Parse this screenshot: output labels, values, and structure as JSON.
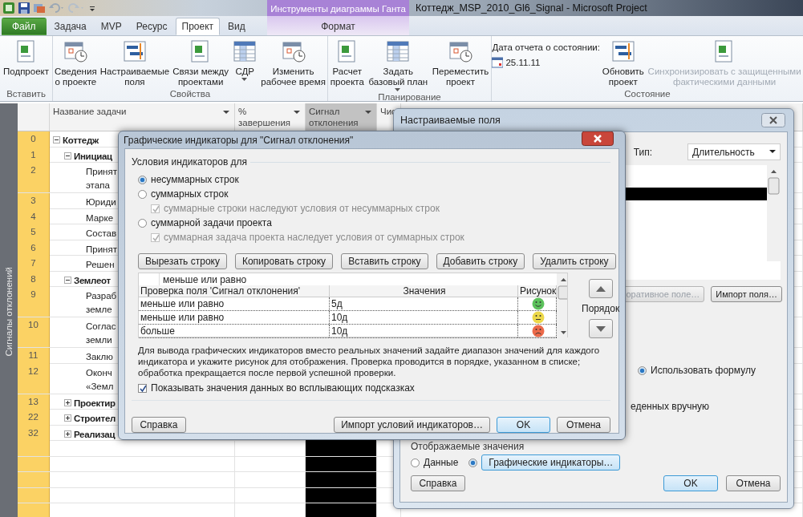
{
  "window": {
    "title": "Коттедж_MSP_2010_Gl6_Signal  -  Microsoft Project"
  },
  "contextual_group": "Инструменты диаграммы Ганта",
  "tabs": [
    {
      "label": "Файл",
      "kind": "file",
      "selected": false
    },
    {
      "label": "Задача",
      "kind": "normal",
      "selected": false
    },
    {
      "label": "MVP",
      "kind": "normal",
      "selected": false
    },
    {
      "label": "Ресурс",
      "kind": "normal",
      "selected": false
    },
    {
      "label": "Проект",
      "kind": "normal",
      "selected": true
    },
    {
      "label": "Вид",
      "kind": "normal",
      "selected": false
    },
    {
      "label": "Формат",
      "kind": "contextual",
      "selected": false
    }
  ],
  "ribbon": {
    "groups": [
      {
        "label": "Вставить",
        "items": [
          {
            "kind": "button",
            "lines": [
              "Подпроект"
            ],
            "dropdown": false,
            "disabled": false
          }
        ]
      },
      {
        "label": "Свойства",
        "items": [
          {
            "kind": "button",
            "lines": [
              "Сведения",
              "о проекте"
            ],
            "dropdown": false,
            "disabled": false
          },
          {
            "kind": "button",
            "lines": [
              "Настраиваемые",
              "поля"
            ],
            "dropdown": false,
            "disabled": false
          },
          {
            "kind": "button",
            "lines": [
              "Связи между",
              "проектами"
            ],
            "dropdown": false,
            "disabled": false
          },
          {
            "kind": "button",
            "lines": [
              "СДР"
            ],
            "dropdown": true,
            "disabled": false
          },
          {
            "kind": "button",
            "lines": [
              "Изменить",
              "рабочее время"
            ],
            "dropdown": false,
            "disabled": false
          }
        ]
      },
      {
        "label": "Планирование",
        "items": [
          {
            "kind": "button",
            "lines": [
              "Расчет",
              "проекта"
            ],
            "dropdown": false,
            "disabled": false
          },
          {
            "kind": "button",
            "lines": [
              "Задать",
              "базовый план"
            ],
            "dropdown": true,
            "disabled": false
          },
          {
            "kind": "button",
            "lines": [
              "Переместить",
              "проект"
            ],
            "dropdown": false,
            "disabled": false
          }
        ]
      },
      {
        "label": "Состояние",
        "items": [
          {
            "kind": "date",
            "label": "Дата отчета о состоянии:",
            "value": "25.11.11"
          },
          {
            "kind": "button",
            "lines": [
              "Обновить",
              "проект"
            ],
            "dropdown": false,
            "disabled": false
          },
          {
            "kind": "button",
            "lines": [
              "Синхронизировать с защищенными",
              "фактическими данными"
            ],
            "dropdown": false,
            "disabled": true
          }
        ]
      }
    ]
  },
  "side_label": "Сигналы отклонений",
  "table": {
    "columns": [
      {
        "label": "Название задачи",
        "selected": false
      },
      {
        "label": "% завершения",
        "selected": false
      },
      {
        "label": "Сигнал отклонения",
        "selected": true
      },
      {
        "label": "Чис",
        "selected": false
      }
    ]
  },
  "tasks": [
    {
      "id": "0",
      "lines": [
        "Коттедж"
      ],
      "summary": true,
      "expanded": true,
      "children": [
        {
          "id": "1",
          "lines": [
            "Инициац"
          ],
          "summary": true,
          "expanded": true,
          "children": [
            {
              "id": "2",
              "lines": [
                "Принят",
                "этапа"
              ],
              "summary": false
            },
            {
              "id": "3",
              "lines": [
                "Юриди"
              ],
              "summary": false
            },
            {
              "id": "4",
              "lines": [
                "Марке"
              ],
              "summary": false
            },
            {
              "id": "5",
              "lines": [
                "Состав"
              ],
              "summary": false
            },
            {
              "id": "6",
              "lines": [
                "Принят"
              ],
              "summary": false
            },
            {
              "id": "7",
              "lines": [
                "Решен"
              ],
              "summary": false
            }
          ]
        },
        {
          "id": "8",
          "lines": [
            "Землеот"
          ],
          "summary": true,
          "expanded": true,
          "children": [
            {
              "id": "9",
              "lines": [
                "Разраб",
                "земле"
              ],
              "summary": false
            },
            {
              "id": "10",
              "lines": [
                "Соглас",
                "земли"
              ],
              "summary": false
            },
            {
              "id": "11",
              "lines": [
                "Заклю"
              ],
              "summary": false
            },
            {
              "id": "12",
              "lines": [
                "Оконч",
                "«Земл"
              ],
              "summary": false
            }
          ]
        },
        {
          "id": "13",
          "lines": [
            "Проектир"
          ],
          "summary": true,
          "expanded": false
        },
        {
          "id": "22",
          "lines": [
            "Строител"
          ],
          "summary": true,
          "expanded": false
        },
        {
          "id": "32",
          "lines": [
            "Реализац"
          ],
          "summary": true,
          "expanded": false
        }
      ]
    }
  ],
  "custom_fields_dialog": {
    "title": "Настраиваемые поля",
    "type_label": "Тип:",
    "type_value": "Длительность",
    "buttons": [
      {
        "label": "оративное поле…",
        "disabled": true
      },
      {
        "label": "Импорт поля…",
        "disabled": false
      }
    ],
    "formula_option": {
      "label": "Использовать формулу",
      "selected": true
    },
    "partial_text": "еденных вручную",
    "display_label": "Отображаемые значения",
    "display_options": [
      {
        "label": "Данные",
        "selected": false,
        "kind": "radio"
      },
      {
        "label": "Графические индикаторы…",
        "selected": true,
        "kind": "button"
      }
    ],
    "footer": [
      {
        "label": "Справка",
        "kind": "normal"
      },
      {
        "label": "OK",
        "kind": "default"
      },
      {
        "label": "Отмена",
        "kind": "normal"
      }
    ]
  },
  "indicators_dialog": {
    "title": "Графические индикаторы для \"Сигнал отклонения\"",
    "group_label": "Условия индикаторов для",
    "options": [
      {
        "kind": "radio",
        "label": "несуммарных строк",
        "selected": true
      },
      {
        "kind": "radio",
        "label": "суммарных строк",
        "selected": false
      },
      {
        "kind": "check",
        "label": "суммарные строки наследуют условия от несуммарных строк",
        "checked": true,
        "disabled": true
      },
      {
        "kind": "radio",
        "label": "суммарной задачи проекта",
        "selected": false
      },
      {
        "kind": "check",
        "label": "суммарная задача проекта наследует условия от суммарных строк",
        "checked": true,
        "disabled": true
      }
    ],
    "row_buttons": [
      "Вырезать строку",
      "Копировать строку",
      "Вставить строку",
      "Добавить строку",
      "Удалить строку"
    ],
    "edit_value": "меньше или равно",
    "columns": [
      "Проверка поля 'Сигнал отклонения'",
      "Значения",
      "Рисунок"
    ],
    "rules": [
      {
        "test": "меньше или равно",
        "value": "5д",
        "kind": "smile",
        "color": "#5cc25c"
      },
      {
        "test": "меньше или равно",
        "value": "10д",
        "kind": "neutral",
        "color": "#ecd84a"
      },
      {
        "test": "больше",
        "value": "10д",
        "kind": "frown",
        "color": "#ec6a4a"
      }
    ],
    "order_label": "Порядок",
    "note": "Для вывода графических индикаторов вместо реальных значений задайте диапазон значений для каждого индикатора и укажите рисунок для отображения.  Проверка проводится в порядке, указанном в списке; обработка прекращается после первой успешной проверки.",
    "tooltip_option": {
      "label": "Показывать значения данных во всплывающих подсказках",
      "checked": true
    },
    "footer": [
      {
        "label": "Справка",
        "kind": "normal"
      },
      {
        "label": "Импорт условий индикаторов…",
        "kind": "normal"
      },
      {
        "label": "OK",
        "kind": "default"
      },
      {
        "label": "Отмена",
        "kind": "normal"
      }
    ]
  }
}
